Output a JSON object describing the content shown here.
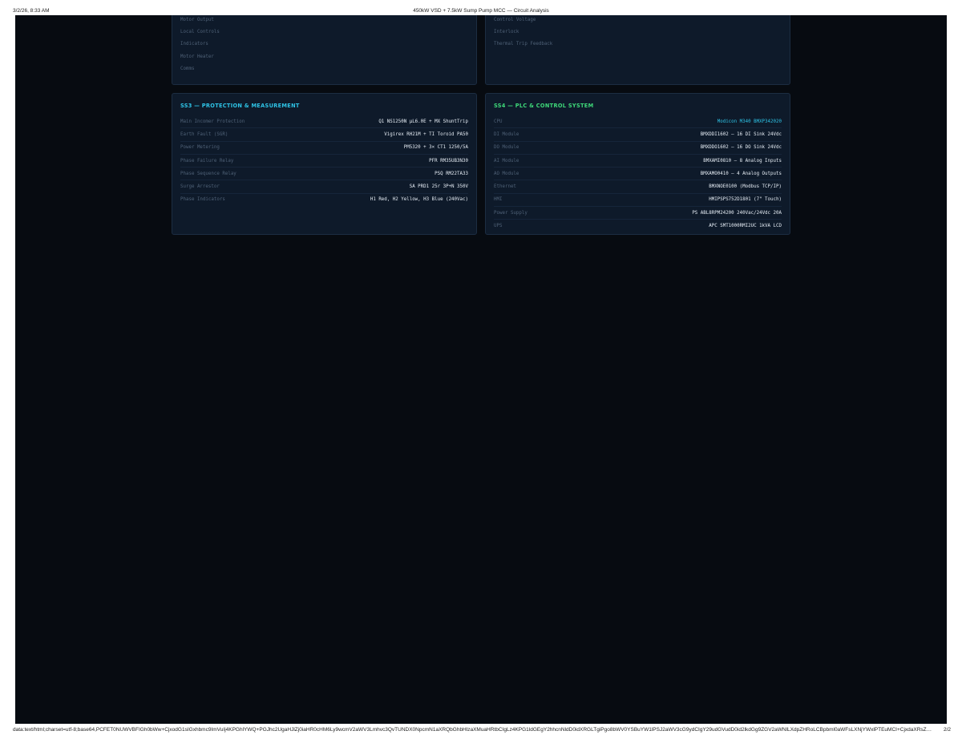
{
  "print_header": {
    "date": "3/2/26, 8:33 AM",
    "title": "450kW VSD + 7.5kW Sump Pump MCC — Circuit Analysis"
  },
  "print_footer": {
    "url": "data:text/html;charset=utf-8;base64,PCFET0NUWVBFIGh0bWw+CjxodG1sIGxhbmc9ImVuIj4KPGhlYWQ+PGJhc2UgaHJlZj0iaHR0cHM6Ly9wcmV2aWV3Lmhvc3QvTUNDX0NpcmN1aXRQbGhbHlzaXMuaHRtbCIgLz4KPG1ldGEgY2hhcnNldD0idXRGLTgiPgo8bWV0YSBuYW1lPSJ2aWV3cG9ydCIgY29udGVudD0id2lkdGg9ZGV2aWNlLXdpZHRoLCBpbml0aWFsLXNjYWxlPTEuMCI+CjxdaXRsZT40NTBrVyBWU0QgKyA3LjVrVyBTdW1wIFB1bXAgTUNDIOKAlCBDaXJjdWl0...",
    "page": "2/2"
  },
  "top_left_panel": {
    "items": [
      "Motor Output",
      "Local Controls",
      "Indicators",
      "Motor Heater",
      "Comms"
    ]
  },
  "top_right_panel": {
    "items": [
      "Control Voltage",
      "Interlock",
      "Thermal Trip Feedback"
    ]
  },
  "ss3": {
    "title": "SS3 — PROTECTION & MEASUREMENT",
    "rows": [
      {
        "k": "Main Incomer Protection",
        "v": "Q1 NS1250N µL6.0E + MX ShuntTrip"
      },
      {
        "k": "Earth Fault (SGR)",
        "v": "Vigirex RH21M + TI Toroid PA50"
      },
      {
        "k": "Power Metering",
        "v": "PM5320 + 3× CT1 1250/5A"
      },
      {
        "k": "Phase Failure Relay",
        "v": "PFR RM35UB3N30"
      },
      {
        "k": "Phase Sequence Relay",
        "v": "PSQ RM22TA33"
      },
      {
        "k": "Surge Arrestor",
        "v": "SA PRD1 25r 3P+N 350V"
      },
      {
        "k": "Phase Indicators",
        "v": "H1 Red, H2 Yellow, H3 Blue (240Vac)"
      }
    ]
  },
  "ss4": {
    "title": "SS4 — PLC & CONTROL SYSTEM",
    "rows": [
      {
        "k": "CPU",
        "v": "Modicon M340 BMXP342020"
      },
      {
        "k": "DI Module",
        "v": "BMXDDI1602 — 16 DI Sink 24Vdc"
      },
      {
        "k": "DO Module",
        "v": "BMXDDO1602 — 16 DO Sink 24Vdc"
      },
      {
        "k": "AI Module",
        "v": "BMXAMI0810 — 8 Analog Inputs"
      },
      {
        "k": "AO Module",
        "v": "BMXAMO0410 — 4 Analog Outputs"
      },
      {
        "k": "Ethernet",
        "v": "BMXNOE0100 (Modbus TCP/IP)"
      },
      {
        "k": "HMI",
        "v": "HMIPSPS752D1801 (7\" Touch)"
      },
      {
        "k": "Power Supply",
        "v": "PS ABL8RPM24200 240Vac/24Vdc 20A"
      },
      {
        "k": "UPS",
        "v": "APC SMT1000RMI2UC 1kVA LCD"
      }
    ]
  },
  "colors": {
    "background": "#070b11",
    "panel": "#0e1a2a",
    "ss3_accent": "#2ec3e6",
    "ss4_accent": "#3ed879"
  }
}
